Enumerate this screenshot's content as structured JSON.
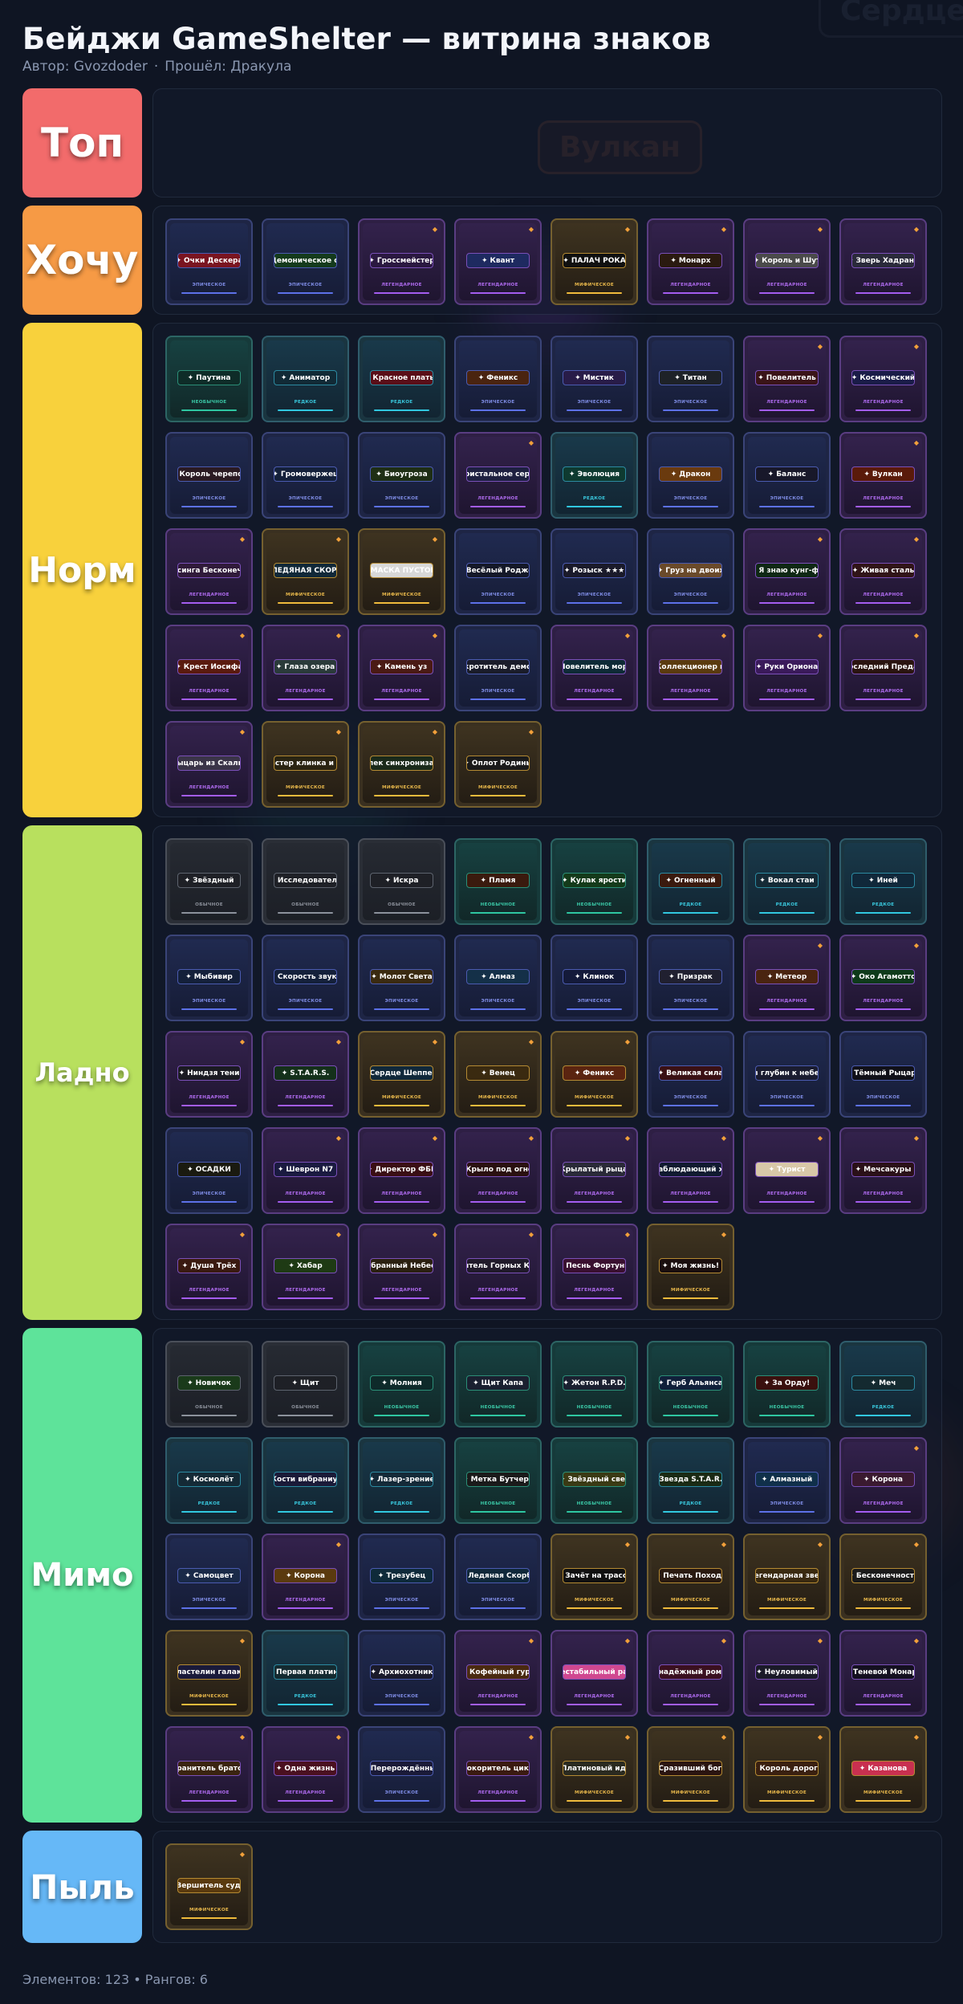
{
  "header": {
    "title": "Бейджи GameShelter — витрина знаков",
    "author": "Автор: Gvozdoder",
    "passed": "Прошёл: Дракула"
  },
  "rarity_labels": {
    "common": "ОБЫЧНОЕ",
    "uncommon": "НЕОБЫЧНОЕ",
    "rare": "РЕДКОЕ",
    "epic": "ЭПИЧЕСКОЕ",
    "legendary": "ЛЕГЕНДАРНОЕ",
    "mythic": "МИФИЧЕСКОЕ"
  },
  "background_words": [
    "Вулкан",
    "Сердце"
  ],
  "tiers": [
    {
      "label": "Топ",
      "color": "#f26b6b",
      "badges": []
    },
    {
      "label": "Хочу",
      "color": "#f69a45",
      "badges": [
        {
          "name": "Очки Дескера",
          "rarity": "epic",
          "plate": "#7a1420"
        },
        {
          "name": "Демоническое око",
          "rarity": "epic",
          "plate": "#143a1c"
        },
        {
          "name": "Гроссмейстер",
          "rarity": "legendary",
          "plate": "#2a1840"
        },
        {
          "name": "Квант",
          "rarity": "legendary",
          "plate": "#1e2a60"
        },
        {
          "name": "ПАЛАЧ РОКА",
          "rarity": "mythic",
          "plate": "#101010"
        },
        {
          "name": "Монарх",
          "rarity": "legendary",
          "plate": "#2a1a10"
        },
        {
          "name": "Король и Шут",
          "rarity": "legendary",
          "plate": "#4a4a4a"
        },
        {
          "name": "Зверь Хадрана",
          "rarity": "legendary",
          "plate": "#2a2a3a"
        }
      ]
    },
    {
      "label": "Норм",
      "color": "#f8d13c",
      "badges": [
        {
          "name": "Паутина",
          "rarity": "uncommon",
          "plate": "#0e2c28"
        },
        {
          "name": "Аниматор",
          "rarity": "rare",
          "plate": "#112a36"
        },
        {
          "name": "Красное платье",
          "rarity": "rare",
          "plate": "#5a0e18"
        },
        {
          "name": "Феникс",
          "rarity": "epic",
          "plate": "#4a2410"
        },
        {
          "name": "Мистик",
          "rarity": "epic",
          "plate": "#281c48"
        },
        {
          "name": "Титан",
          "rarity": "epic",
          "plate": "#1e2228"
        },
        {
          "name": "Повелитель",
          "rarity": "legendary",
          "plate": "#3a1418"
        },
        {
          "name": "Космический",
          "rarity": "legendary",
          "plate": "#1a1c48"
        },
        {
          "name": "Король черепов",
          "rarity": "epic",
          "plate": "#2a1a22"
        },
        {
          "name": "Громовержец",
          "rarity": "epic",
          "plate": "#14203a"
        },
        {
          "name": "Биоугроза",
          "rarity": "epic",
          "plate": "#1e2e14"
        },
        {
          "name": "Кристальное сердце",
          "rarity": "legendary",
          "plate": "#1e2040"
        },
        {
          "name": "Эволюция",
          "rarity": "rare",
          "plate": "#0e3a30"
        },
        {
          "name": "Дракон",
          "rarity": "epic",
          "plate": "#6a3a0e"
        },
        {
          "name": "Баланс",
          "rarity": "epic",
          "plate": "#18182a"
        },
        {
          "name": "Вулкан",
          "rarity": "legendary",
          "plate": "#5a1a0a"
        },
        {
          "name": "Пирсинга Бесконечности",
          "rarity": "legendary",
          "plate": "#301a3a"
        },
        {
          "name": "ЛЕДЯНАЯ СКОРБЬ",
          "rarity": "mythic",
          "plate": "#102838"
        },
        {
          "name": "МАСКА ПУСТОГО",
          "rarity": "mythic",
          "plate": "#d8d8d8"
        },
        {
          "name": "Весёлый Роджер",
          "rarity": "epic",
          "plate": "#141828"
        },
        {
          "name": "Розыск ★★★",
          "rarity": "epic",
          "plate": "#1a1a2a"
        },
        {
          "name": "Груз на двоих",
          "rarity": "epic",
          "plate": "#6a4a2a"
        },
        {
          "name": "Я знаю кунг-фу",
          "rarity": "legendary",
          "plate": "#0e2814"
        },
        {
          "name": "Живая сталь",
          "rarity": "legendary",
          "plate": "#301418"
        },
        {
          "name": "Крест Иосифа",
          "rarity": "legendary",
          "plate": "#5a1a0e"
        },
        {
          "name": "Глаза озера",
          "rarity": "legendary",
          "plate": "#2a3a3a"
        },
        {
          "name": "Камень уз",
          "rarity": "legendary",
          "plate": "#4a1a14"
        },
        {
          "name": "Укротитель демонов",
          "rarity": "epic",
          "plate": "#1a1c2a"
        },
        {
          "name": "Повелитель морей",
          "rarity": "legendary",
          "plate": "#0e2a36"
        },
        {
          "name": "Коллекционер игр",
          "rarity": "legendary",
          "plate": "#5a3a0e"
        },
        {
          "name": "Руки Ориона",
          "rarity": "legendary",
          "plate": "#3a1a5a"
        },
        {
          "name": "Последний Предатор",
          "rarity": "legendary",
          "plate": "#2a1410"
        },
        {
          "name": "Рыцарь из Скалицы",
          "rarity": "legendary",
          "plate": "#3a3448"
        },
        {
          "name": "Мастер клинка и лука",
          "rarity": "mythic",
          "plate": "#2a2412"
        },
        {
          "name": "Элек синхронизация",
          "rarity": "mythic",
          "plate": "#1a2a1a"
        },
        {
          "name": "Оплот Родины",
          "rarity": "mythic",
          "plate": "#1a1a1a"
        }
      ]
    },
    {
      "label": "Ладно",
      "color": "#b8e05e",
      "badges": [
        {
          "name": "Звёздный",
          "rarity": "common",
          "plate": "#1e2026"
        },
        {
          "name": "Исследователь",
          "rarity": "common",
          "plate": "#1e2026"
        },
        {
          "name": "Искра",
          "rarity": "common",
          "plate": "#1e2026"
        },
        {
          "name": "Пламя",
          "rarity": "uncommon",
          "plate": "#3a1a0e"
        },
        {
          "name": "Кулак ярости",
          "rarity": "uncommon",
          "plate": "#143a1a"
        },
        {
          "name": "Огненный",
          "rarity": "rare",
          "plate": "#3a1a0e"
        },
        {
          "name": "Вокал стаи",
          "rarity": "rare",
          "plate": "#142a36"
        },
        {
          "name": "Иней",
          "rarity": "rare",
          "plate": "#10283a"
        },
        {
          "name": "Мыбивир",
          "rarity": "epic",
          "plate": "#14203a"
        },
        {
          "name": "Скорость звука",
          "rarity": "epic",
          "plate": "#14203a"
        },
        {
          "name": "Молот Света",
          "rarity": "epic",
          "plate": "#3a2a10"
        },
        {
          "name": "Алмаз",
          "rarity": "epic",
          "plate": "#143048"
        },
        {
          "name": "Клинок",
          "rarity": "epic",
          "plate": "#141a3a"
        },
        {
          "name": "Призрак",
          "rarity": "epic",
          "plate": "#202030"
        },
        {
          "name": "Метеор",
          "rarity": "legendary",
          "plate": "#4a2410"
        },
        {
          "name": "Око Агамотто",
          "rarity": "legendary",
          "plate": "#0e3a1a"
        },
        {
          "name": "Ниндзя тени",
          "rarity": "legendary",
          "plate": "#1a1a22"
        },
        {
          "name": "S.T.A.R.S.",
          "rarity": "legendary",
          "plate": "#14301a"
        },
        {
          "name": "Сердце Шеппера",
          "rarity": "mythic",
          "plate": "#10283a"
        },
        {
          "name": "Венец",
          "rarity": "mythic",
          "plate": "#3a2a10"
        },
        {
          "name": "Феникс",
          "rarity": "mythic",
          "plate": "#5a2410"
        },
        {
          "name": "Великая сила",
          "rarity": "epic",
          "plate": "#3a1014"
        },
        {
          "name": "Из глубин к небесам",
          "rarity": "epic",
          "plate": "#1a1c30"
        },
        {
          "name": "Тёмный Рыцарь",
          "rarity": "epic",
          "plate": "#101018"
        },
        {
          "name": "ОСАДКИ",
          "rarity": "epic",
          "plate": "#1a1a10"
        },
        {
          "name": "Шеврон N7",
          "rarity": "legendary",
          "plate": "#1a1a40"
        },
        {
          "name": "Директор ФБК",
          "rarity": "legendary",
          "plate": "#3a0e14"
        },
        {
          "name": "Крыло под огнём",
          "rarity": "legendary",
          "plate": "#2a1010"
        },
        {
          "name": "Крылатый рыцарь",
          "rarity": "legendary",
          "plate": "#2a2a38"
        },
        {
          "name": "Наблюдающий хаос",
          "rarity": "legendary",
          "plate": "#101a30"
        },
        {
          "name": "Турист",
          "rarity": "legendary",
          "plate": "#d8c8a8"
        },
        {
          "name": "Мечсакуры",
          "rarity": "legendary",
          "plate": "#2a1018"
        },
        {
          "name": "Душа Трёх",
          "rarity": "legendary",
          "plate": "#3a1a10"
        },
        {
          "name": "Хабар",
          "rarity": "legendary",
          "plate": "#1e3a14"
        },
        {
          "name": "Избранный Небесами",
          "rarity": "legendary",
          "plate": "#2a2010"
        },
        {
          "name": "Разрушитель Горных Королевств",
          "rarity": "legendary",
          "plate": "#201a2a"
        },
        {
          "name": "Песнь Фортуны",
          "rarity": "legendary",
          "plate": "#3a1030"
        },
        {
          "name": "Моя жизнь!",
          "rarity": "mythic",
          "plate": "#1a0e0e"
        }
      ]
    },
    {
      "label": "Мимо",
      "color": "#5ee39a",
      "badges": [
        {
          "name": "Новичок",
          "rarity": "common",
          "plate": "#1a3a1a"
        },
        {
          "name": "Щит",
          "rarity": "common",
          "plate": "#1e2026"
        },
        {
          "name": "Молния",
          "rarity": "uncommon",
          "plate": "#0e2a2a"
        },
        {
          "name": "Щит Капа",
          "rarity": "uncommon",
          "plate": "#1a2030"
        },
        {
          "name": "Жетон R.P.D.",
          "rarity": "uncommon",
          "plate": "#1a2030"
        },
        {
          "name": "Герб Альянса",
          "rarity": "uncommon",
          "plate": "#10203a"
        },
        {
          "name": "За Орду!",
          "rarity": "uncommon",
          "plate": "#3a100e"
        },
        {
          "name": "Меч",
          "rarity": "rare",
          "plate": "#142a30"
        },
        {
          "name": "Космолёт",
          "rarity": "rare",
          "plate": "#142a36"
        },
        {
          "name": "Кости вибраниума",
          "rarity": "rare",
          "plate": "#1a1a38"
        },
        {
          "name": "Лазер-зрение",
          "rarity": "rare",
          "plate": "#142a38"
        },
        {
          "name": "Метка Бутчера",
          "rarity": "uncommon",
          "plate": "#1a1a1a"
        },
        {
          "name": "Звёздный свет",
          "rarity": "uncommon",
          "plate": "#3a3a14"
        },
        {
          "name": "Звезда S.T.A.R.S.",
          "rarity": "rare",
          "plate": "#1a2a14"
        },
        {
          "name": "Алмазный",
          "rarity": "epic",
          "plate": "#10304a"
        },
        {
          "name": "Корона",
          "rarity": "legendary",
          "plate": "#3a1a30"
        },
        {
          "name": "Самоцвет",
          "rarity": "epic",
          "plate": "#1a2a48"
        },
        {
          "name": "Корона",
          "rarity": "legendary",
          "plate": "#5a3a0e"
        },
        {
          "name": "Трезубец",
          "rarity": "epic",
          "plate": "#0e2a3a"
        },
        {
          "name": "Ледяная Скорбь",
          "rarity": "epic",
          "plate": "#10283a"
        },
        {
          "name": "Зачёт на трассе",
          "rarity": "mythic",
          "plate": "#101010"
        },
        {
          "name": "Печать Похода",
          "rarity": "mythic",
          "plate": "#2a1a10"
        },
        {
          "name": "Легендарная звезда",
          "rarity": "mythic",
          "plate": "#3a2a10"
        },
        {
          "name": "Бесконечность",
          "rarity": "mythic",
          "plate": "#1a1a1a"
        },
        {
          "name": "Властелин галактик",
          "rarity": "mythic",
          "plate": "#1a1a3a"
        },
        {
          "name": "Первая платина",
          "rarity": "rare",
          "plate": "#142a30"
        },
        {
          "name": "Архиохотник",
          "rarity": "epic",
          "plate": "#1a1a2a"
        },
        {
          "name": "Кофейный гуру",
          "rarity": "legendary",
          "plate": "#4a2a10"
        },
        {
          "name": "Нестабильный разум",
          "rarity": "legendary",
          "plate": "#d04890"
        },
        {
          "name": "Безнадёжный романтик",
          "rarity": "legendary",
          "plate": "#3a1020"
        },
        {
          "name": "Неуловимый",
          "rarity": "legendary",
          "plate": "#1a1a28"
        },
        {
          "name": "Теневой Монарх",
          "rarity": "legendary",
          "plate": "#141020"
        },
        {
          "name": "Хранитель братства",
          "rarity": "legendary",
          "plate": "#3a2410"
        },
        {
          "name": "Одна жизнь",
          "rarity": "legendary",
          "plate": "#4a1020"
        },
        {
          "name": "Перерождённый",
          "rarity": "epic",
          "plate": "#1a1a38"
        },
        {
          "name": "Покоритель циклов",
          "rarity": "legendary",
          "plate": "#3a1a10"
        },
        {
          "name": "Платиновый идол",
          "rarity": "mythic",
          "plate": "#2a2a20"
        },
        {
          "name": "Сразивший богов",
          "rarity": "mythic",
          "plate": "#2a1410"
        },
        {
          "name": "Король дороги",
          "rarity": "mythic",
          "plate": "#3a2010"
        },
        {
          "name": "Казанова",
          "rarity": "mythic",
          "plate": "#c83050"
        }
      ]
    },
    {
      "label": "Пыль",
      "color": "#66b8f7",
      "badges": [
        {
          "name": "Вершитель судеб",
          "rarity": "mythic",
          "plate": "#5a3a0e"
        }
      ]
    }
  ],
  "footer": "Элементов: 123 • Рангов: 6"
}
